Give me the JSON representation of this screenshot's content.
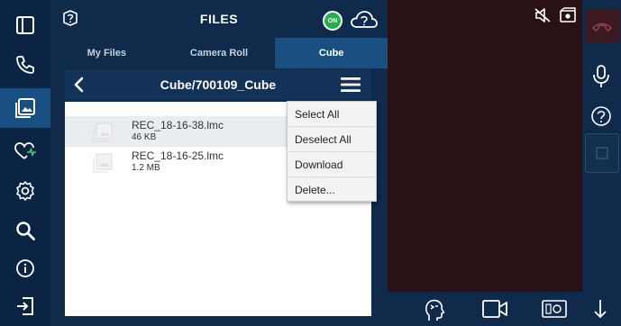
{
  "header": {
    "title": "FILES",
    "status_badge": "ON"
  },
  "tabs": [
    {
      "label": "My Files",
      "active": false
    },
    {
      "label": "Camera Roll",
      "active": false
    },
    {
      "label": "Cube",
      "active": true
    }
  ],
  "path": "Cube/700109_Cube",
  "files": [
    {
      "name": "REC_18-16-38.lmc",
      "size": "46 KB",
      "selected": true
    },
    {
      "name": "REC_18-16-25.lmc",
      "size": "1.2 MB",
      "selected": false
    }
  ],
  "context_menu": {
    "items": [
      "Select All",
      "Deselect All",
      "Download",
      "Delete..."
    ]
  },
  "sidebar": {
    "items": [
      {
        "icon": "panel-toggle-icon",
        "active": false
      },
      {
        "icon": "phone-icon",
        "active": false
      },
      {
        "icon": "image-gallery-icon",
        "active": true
      },
      {
        "icon": "heart-vitals-icon",
        "active": false
      },
      {
        "icon": "gear-icon",
        "active": false
      },
      {
        "icon": "search-icon",
        "active": false
      },
      {
        "icon": "info-icon",
        "active": false
      },
      {
        "icon": "logout-icon",
        "active": false
      }
    ]
  },
  "colors": {
    "navy": "#0f2a4a",
    "active_blue": "#1a4f82",
    "on_green": "#22b14c",
    "video_bg": "#291116"
  }
}
